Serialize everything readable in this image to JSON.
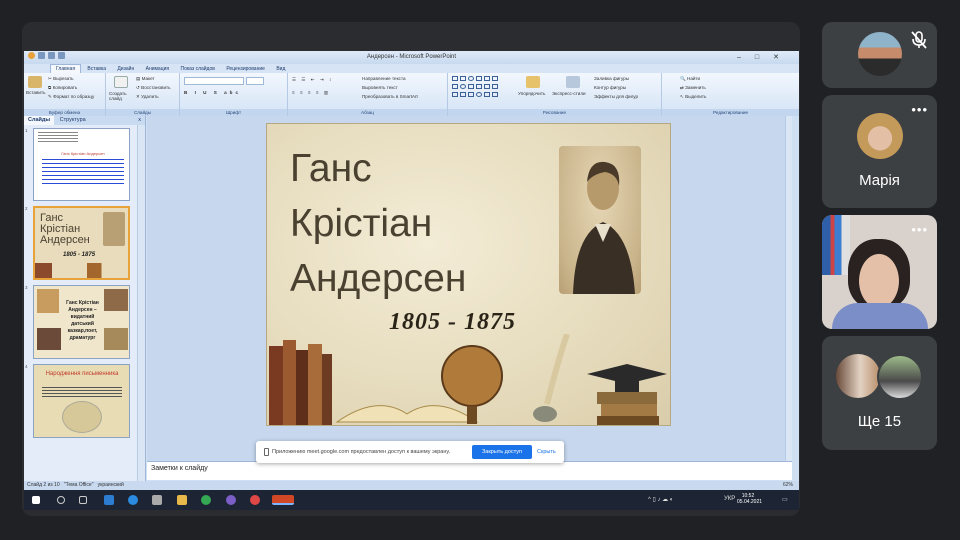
{
  "powerpoint": {
    "window_title": "Андерсен - Microsoft PowerPoint",
    "tabs": [
      "Главная",
      "Вставка",
      "Дизайн",
      "Анимация",
      "Показ слайдов",
      "Рецензирование",
      "Вид"
    ],
    "ribbon": {
      "paste": "Вставить",
      "cut": "Вырезать",
      "copy": "Копировать",
      "format_painter": "Формат по образцу",
      "clipboard_group": "Буфер обмена",
      "create_slide": "Создать слайд",
      "layout": "Макет",
      "reset": "Восстановить",
      "delete": "Удалить",
      "slides_group": "Слайды",
      "font_group": "Шрифт",
      "text_direction": "Направление текста",
      "align_text": "Выровнять текст",
      "smartart": "Преобразовать в SmartArt",
      "paragraph_group": "Абзац",
      "arrange": "Упорядочить",
      "quick_styles": "Экспресс-стили",
      "shape_fill": "Заливка фигуры",
      "shape_outline": "Контур фигуры",
      "shape_effects": "Эффекты для фигур",
      "drawing_group": "Рисование",
      "find": "Найти",
      "replace": "Заменить",
      "select": "Выделить",
      "editing_group": "Редактирование"
    },
    "left_pane": {
      "tab_slides": "Слайды",
      "tab_outline": "Структура",
      "close": "x",
      "thumbs": [
        {
          "num": "1",
          "title": "Ганс Крістіан Андерсен"
        },
        {
          "num": "2",
          "title": "Ганс Крістіан Андерсен",
          "years": "1805 - 1875"
        },
        {
          "num": "3",
          "title": "Ганс Крістіан Андерсен – видатний датський казкар,поет, драматург"
        },
        {
          "num": "4",
          "title": "Народження письменника"
        }
      ]
    },
    "slide": {
      "line1": "Ганс",
      "line2": "Крістіан",
      "line3": "Андерсен",
      "years": "1805 - 1875"
    },
    "notes_placeholder": "Заметки к слайду",
    "status": {
      "slide_of": "Слайд 2 из 10",
      "theme": "\"Тема Office\"",
      "language": "украинский",
      "zoom": "62%"
    }
  },
  "share_bar": {
    "message": "Приложению meet.google.com предоставлен доступ к вашему экрану.",
    "stop_label": "Закрыть доступ",
    "hide_label": "Скрыть"
  },
  "taskbar": {
    "lang": "УКР",
    "time": "10:52",
    "date": "05.04.2021"
  },
  "participants": {
    "tile2_name": "Марія",
    "tile4_name": "Ще 15",
    "more_icon": "•••"
  }
}
